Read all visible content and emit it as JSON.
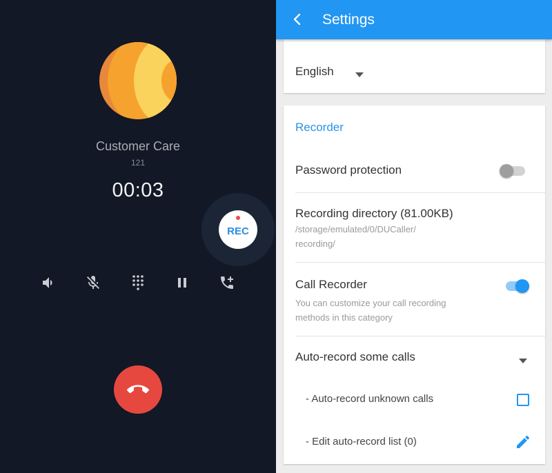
{
  "call": {
    "caller_name": "Customer Care",
    "caller_number": "121",
    "timer": "00:03",
    "rec_label": "REC",
    "controls": [
      "speaker-icon",
      "mute-mic-icon",
      "dialpad-icon",
      "pause-icon",
      "add-call-icon"
    ],
    "colors": {
      "background": "#121825",
      "hangup": "#e6483f",
      "rec_text": "#2a8de0"
    }
  },
  "settings": {
    "title": "Settings",
    "language": {
      "value": "English"
    },
    "recorder": {
      "section_title": "Recorder",
      "password_protection": {
        "label": "Password protection",
        "enabled": false
      },
      "recording_directory": {
        "label": "Recording directory (81.00KB)",
        "path_line1": "/storage/emulated/0/DUCaller/",
        "path_line2": "recording/"
      },
      "call_recorder": {
        "label": "Call Recorder",
        "description_line1": "You can customize your call recording",
        "description_line2": "methods in this category",
        "enabled": true
      },
      "auto_record": {
        "label": "Auto-record some calls",
        "unknown_calls": {
          "label": "- Auto-record unknown calls",
          "checked": false
        },
        "edit_list": {
          "label": "- Edit auto-record list (0)"
        }
      }
    },
    "colors": {
      "appbar": "#2196f3",
      "accent": "#2a93e8"
    }
  }
}
